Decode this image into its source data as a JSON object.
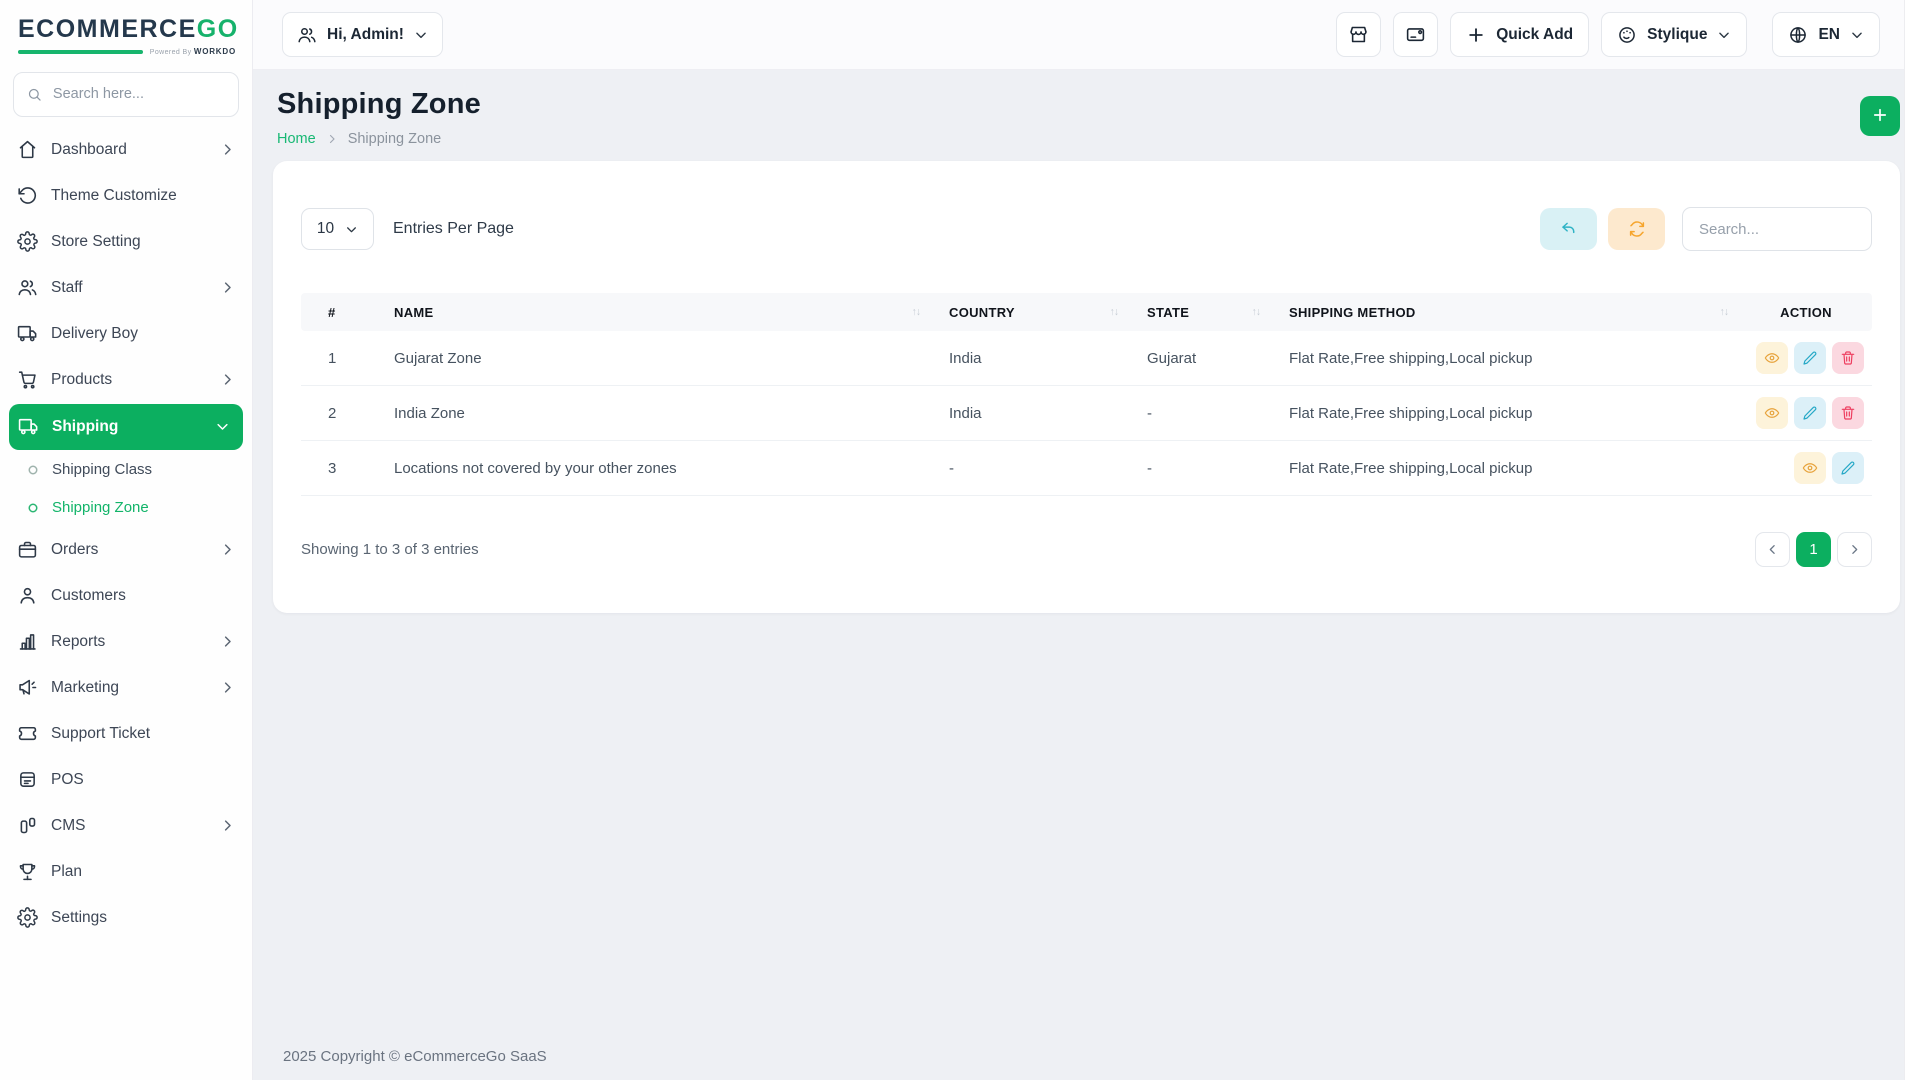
{
  "brand": {
    "name_primary": "ECOMMERCE",
    "name_accent": "GO",
    "powered_by": "Powered By",
    "powered_brand": "WORKDO"
  },
  "topbar": {
    "admin_label": "Hi, Admin!",
    "quick_add_label": "Quick Add",
    "theme_label": "Stylique",
    "language_label": "EN"
  },
  "sidebar": {
    "search_placeholder": "Search here...",
    "items": [
      {
        "label": "Dashboard"
      },
      {
        "label": "Theme Customize"
      },
      {
        "label": "Store Setting"
      },
      {
        "label": "Staff"
      },
      {
        "label": "Delivery Boy"
      },
      {
        "label": "Products"
      },
      {
        "label": "Shipping"
      },
      {
        "label": "Shipping Class"
      },
      {
        "label": "Shipping Zone"
      },
      {
        "label": "Orders"
      },
      {
        "label": "Customers"
      },
      {
        "label": "Reports"
      },
      {
        "label": "Marketing"
      },
      {
        "label": "Support Ticket"
      },
      {
        "label": "POS"
      },
      {
        "label": "CMS"
      },
      {
        "label": "Plan"
      },
      {
        "label": "Settings"
      }
    ]
  },
  "page": {
    "title": "Shipping Zone",
    "breadcrumb": {
      "home": "Home",
      "current": "Shipping Zone"
    }
  },
  "card": {
    "entries": {
      "value": "10",
      "label": "Entries Per Page"
    },
    "search_placeholder": "Search...",
    "table": {
      "headers": {
        "num": "#",
        "name": "NAME",
        "country": "COUNTRY",
        "state": "STATE",
        "method": "SHIPPING METHOD",
        "action": "ACTION"
      },
      "rows": [
        {
          "num": "1",
          "name": "Gujarat Zone",
          "country": "India",
          "state": "Gujarat",
          "method": "Flat Rate,Free shipping,Local pickup"
        },
        {
          "num": "2",
          "name": "India Zone",
          "country": "India",
          "state": "-",
          "method": "Flat Rate,Free shipping,Local pickup"
        },
        {
          "num": "3",
          "name": "Locations not covered by your other zones",
          "country": "-",
          "state": "-",
          "method": "Flat Rate,Free shipping,Local pickup"
        }
      ]
    },
    "showing_text": "Showing 1 to 3 of 3 entries",
    "pagination": {
      "current": "1"
    }
  },
  "footer": {
    "copyright": "2025 Copyright © eCommerceGo SaaS"
  },
  "colors": {
    "primary_green": "#0caf60",
    "view_icon": "#e7a33c",
    "edit_icon": "#25a8c6",
    "delete_icon": "#ee3f60",
    "undo_button": "#d9f1f5",
    "refresh_button": "#fde9ce"
  }
}
